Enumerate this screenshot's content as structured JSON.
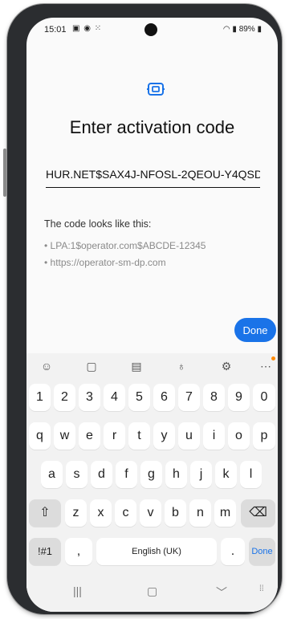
{
  "status": {
    "time": "15:01",
    "left_icons": "▣ ◉ ⁙",
    "right": "89%"
  },
  "header": {
    "title": "Enter activation code"
  },
  "input": {
    "value": "HUR.NET$SAX4J-NFOSL-2QEOU-Y4QSD"
  },
  "hint": {
    "heading": "The code looks like this:",
    "examples": [
      "• LPA:1$operator.com$ABCDE-12345",
      "• https://operator-sm-dp.com"
    ]
  },
  "actions": {
    "done": "Done"
  },
  "keyboard": {
    "toolbar_icons": [
      "emoji-icon",
      "clipboard-icon",
      "text-edit-icon",
      "mic-icon",
      "settings-icon",
      "more-icon"
    ],
    "rows": [
      [
        "1",
        "2",
        "3",
        "4",
        "5",
        "6",
        "7",
        "8",
        "9",
        "0"
      ],
      [
        "q",
        "w",
        "e",
        "r",
        "t",
        "y",
        "u",
        "i",
        "o",
        "p"
      ],
      [
        "a",
        "s",
        "d",
        "f",
        "g",
        "h",
        "j",
        "k",
        "l"
      ],
      [
        "z",
        "x",
        "c",
        "v",
        "b",
        "n",
        "m"
      ]
    ],
    "symbols_key": "!#1",
    "comma_key": ",",
    "space_label": "English (UK)",
    "period_key": ".",
    "done_key": "Done"
  },
  "colors": {
    "accent": "#1a73e8",
    "keyboard_bg": "#f2f2f2",
    "key_bg": "#ffffff"
  }
}
